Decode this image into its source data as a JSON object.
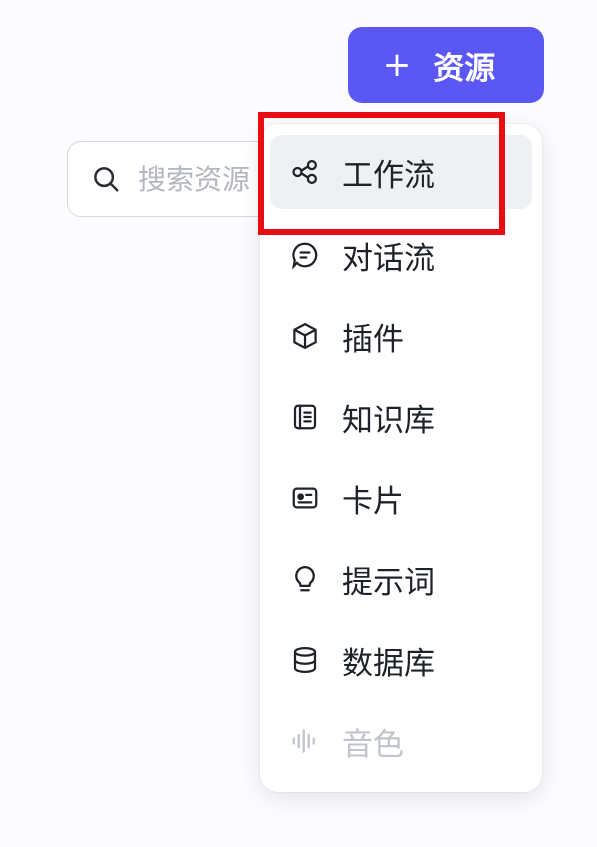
{
  "toolbar": {
    "add_button_plus": "+",
    "add_button_label": "资源",
    "accent_color": "#5b57f5"
  },
  "search": {
    "placeholder": "搜索资源",
    "icon": "search-icon"
  },
  "menu": {
    "items": [
      {
        "label": "工作流",
        "icon": "workflow-icon",
        "selected": true
      },
      {
        "label": "对话流",
        "icon": "chat-flow-icon"
      },
      {
        "label": "插件",
        "icon": "plugin-cube-icon"
      },
      {
        "label": "知识库",
        "icon": "knowledge-base-icon"
      },
      {
        "label": "卡片",
        "icon": "card-icon"
      },
      {
        "label": "提示词",
        "icon": "prompt-bulb-icon"
      },
      {
        "label": "数据库",
        "icon": "database-icon"
      },
      {
        "label": "音色",
        "icon": "voice-waveform-icon",
        "disabled": true
      }
    ]
  },
  "annotation": {
    "highlight_color": "#e80d12"
  }
}
